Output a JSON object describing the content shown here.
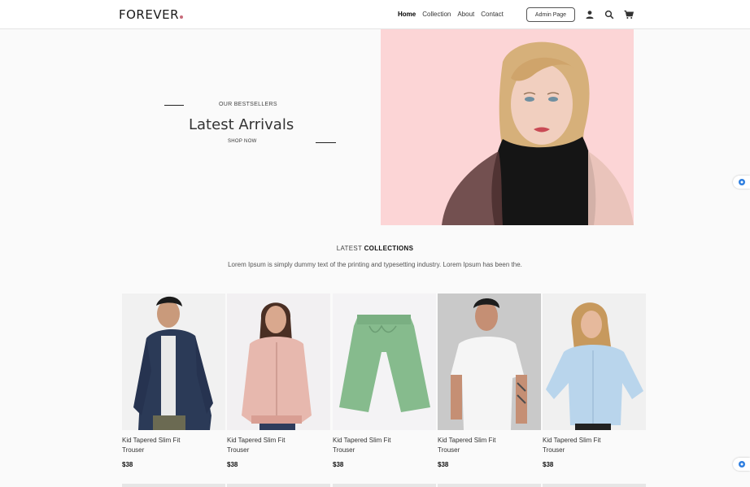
{
  "header": {
    "logo": "FOREVER",
    "nav": [
      "Home",
      "Collection",
      "About",
      "Contact"
    ],
    "admin_label": "Admin Page",
    "icons": [
      "user-icon",
      "search-icon",
      "cart-icon"
    ]
  },
  "hero": {
    "eyebrow": "OUR BESTSELLERS",
    "title": "Latest Arrivals",
    "cta": "SHOP NOW"
  },
  "collections": {
    "title_prefix": "LATEST",
    "title_strong": "COLLECTIONS",
    "description": "Lorem Ipsum is simply dummy text of the printing and typesetting industry. Lorem Ipsum has been the."
  },
  "products": [
    {
      "name": "Kid Tapered Slim Fit Trouser",
      "price": "$38"
    },
    {
      "name": "Kid Tapered Slim Fit Trouser",
      "price": "$38"
    },
    {
      "name": "Kid Tapered Slim Fit Trouser",
      "price": "$38"
    },
    {
      "name": "Kid Tapered Slim Fit Trouser",
      "price": "$38"
    },
    {
      "name": "Kid Tapered Slim Fit Trouser",
      "price": "$38"
    }
  ],
  "colors": {
    "hero_bg": "#fcd5d6",
    "logo_dot": "#c86b7a",
    "widget_accent": "#2f7fe0"
  }
}
